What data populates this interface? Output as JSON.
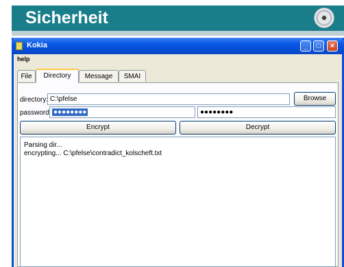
{
  "header": {
    "title": "Sicherheit",
    "icon": "cd-disc-icon",
    "color": "#1a7e8a"
  },
  "window": {
    "title": "Kokia",
    "menu": [
      "help"
    ],
    "tabs": [
      "File",
      "Directory",
      "Message",
      "SMAI"
    ],
    "active_tab": "Directory",
    "directory_label": "directory:",
    "directory_value": "C:\\pfelse",
    "browse_label": "Browse",
    "password_label": "password:",
    "password_value": "●●●●●●●●",
    "password_confirm_value": "●●●●●●●●",
    "encrypt_label": "Encrypt",
    "decrypt_label": "Decrypt",
    "log": [
      "Parsing dir...",
      "encrypting... C:\\pfelse\\contradict_kolscheft.txt"
    ]
  }
}
